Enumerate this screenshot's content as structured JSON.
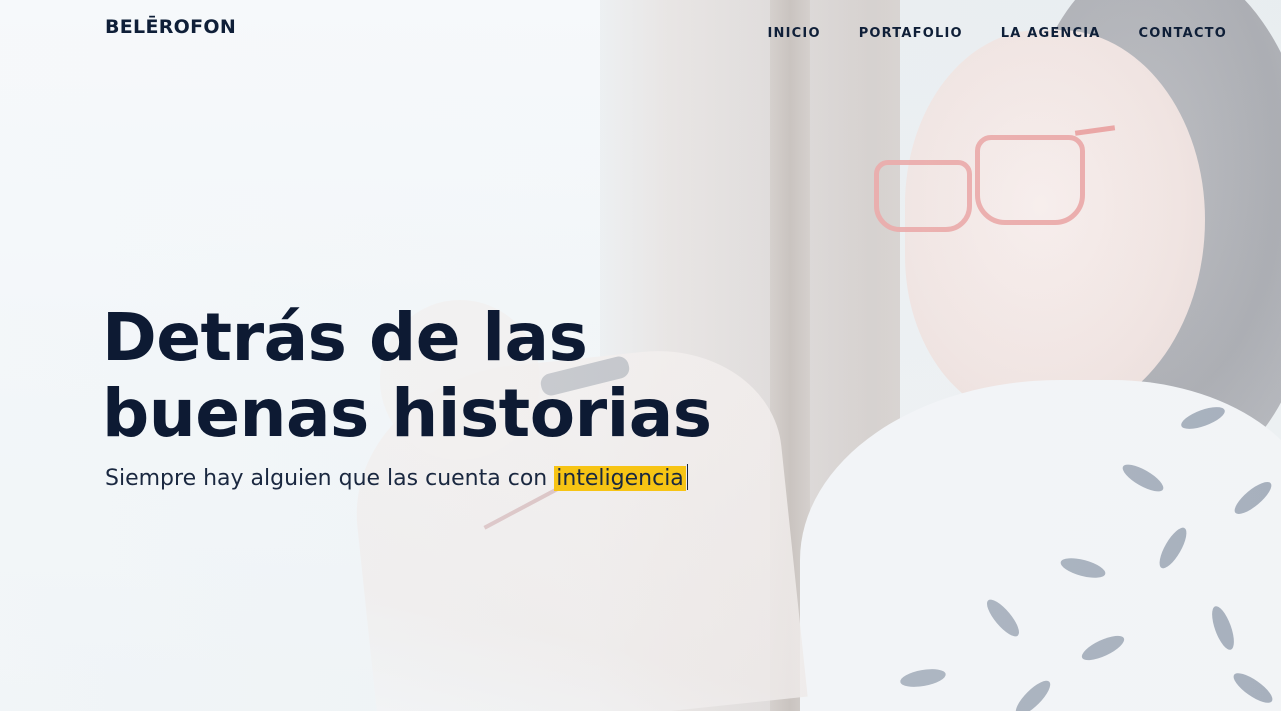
{
  "header": {
    "logo": "BELĒROFON",
    "nav": [
      "INICIO",
      "PORTAFOLIO",
      "LA AGENCIA",
      "CONTACTO"
    ]
  },
  "hero": {
    "headline_line1": "Detrás de las",
    "headline_line2": "buenas historias",
    "subline_prefix": "Siempre hay alguien que las cuenta con ",
    "subline_highlight": "inteligencia"
  },
  "colors": {
    "text": "#0d1a33",
    "highlight": "#f7c414",
    "background": "#f4f7f9"
  }
}
